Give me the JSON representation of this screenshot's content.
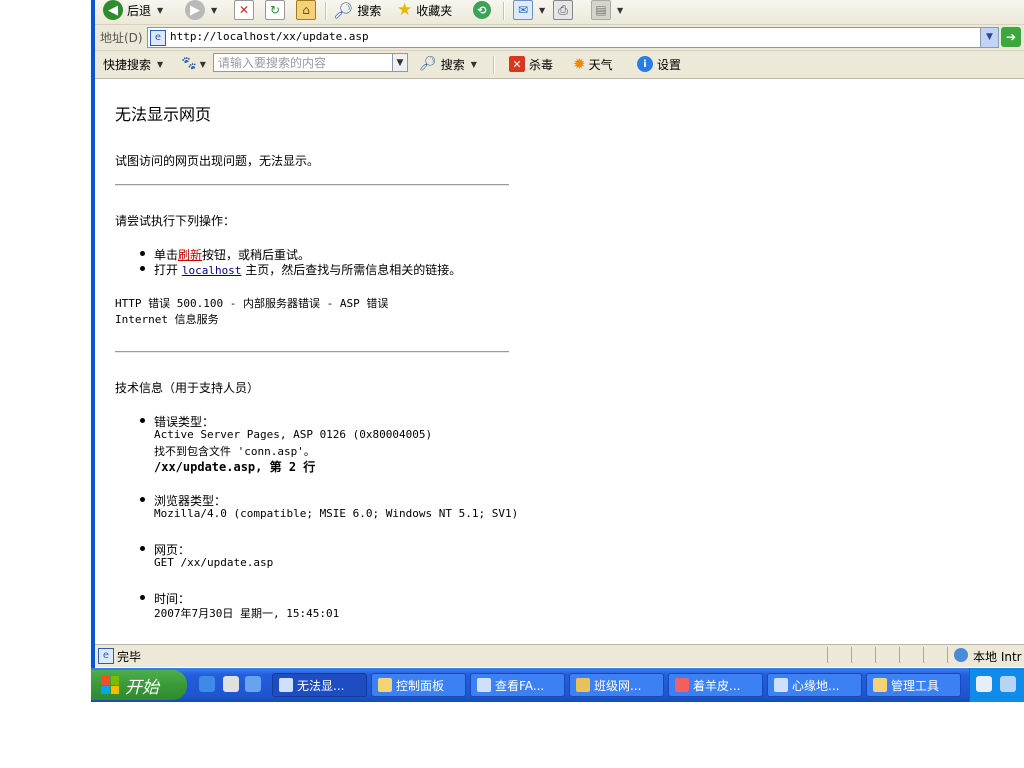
{
  "toolbar": {
    "back_label": "后退",
    "search_label": "搜索",
    "favorites_label": "收藏夹"
  },
  "address_bar": {
    "label": "地址(D)",
    "url": "http://localhost/xx/update.asp"
  },
  "search_toolbar": {
    "quick_search_label": "快捷搜索",
    "search_placeholder": "请输入要搜索的内容",
    "search_button_label": "搜索",
    "antivirus_label": "杀毒",
    "weather_label": "天气",
    "settings_label": "设置"
  },
  "page": {
    "title": "无法显示网页",
    "subtitle": "试图访问的网页出现问题，无法显示。",
    "try_heading": "请尝试执行下列操作：",
    "try_items": {
      "item1_prefix": "单击",
      "item1_link": "刷新",
      "item1_suffix": "按钮，或稍后重试。",
      "item2_prefix": "打开 ",
      "item2_link": "localhost",
      "item2_suffix": " 主页，然后查找与所需信息相关的链接。"
    },
    "error_line1": "HTTP 错误 500.100 - 内部服务器错误 - ASP 错误",
    "error_line2": "Internet 信息服务",
    "tech_heading": "技术信息（用于支持人员）",
    "error_type_label": "错误类型：",
    "error_type_line1": "Active Server Pages, ASP 0126 (0x80004005)",
    "error_type_line2": "找不到包含文件 'conn.asp'。",
    "error_type_line3": "/xx/update.asp, 第 2 行",
    "browser_type_label": "浏览器类型：",
    "browser_type_value": "Mozilla/4.0 (compatible; MSIE 6.0; Windows NT 5.1; SV1)",
    "page_label": "网页：",
    "page_value": "GET /xx/update.asp",
    "time_label": "时间：",
    "time_value": "2007年7月30日 星期一, 15:45:01"
  },
  "status_bar": {
    "status_text": "完毕",
    "zone_text": "本地 Intr"
  },
  "taskbar": {
    "start_label": "开始",
    "tasks": [
      {
        "label": "无法显...",
        "icon": "ie-page-icon"
      },
      {
        "label": "控制面板",
        "icon": "folder-icon"
      },
      {
        "label": "查看FA...",
        "icon": "ie-page-icon"
      },
      {
        "label": "班级网...",
        "icon": "app-icon"
      },
      {
        "label": "着羊皮...",
        "icon": "qq-icon"
      },
      {
        "label": "心缘地...",
        "icon": "ie-page-icon"
      },
      {
        "label": "管理工具",
        "icon": "folder-icon"
      }
    ]
  },
  "colors": {
    "taskbar_blue": "#245edb",
    "start_green": "#3a9a38",
    "link_red": "#c00000",
    "link_blue": "#000080"
  }
}
